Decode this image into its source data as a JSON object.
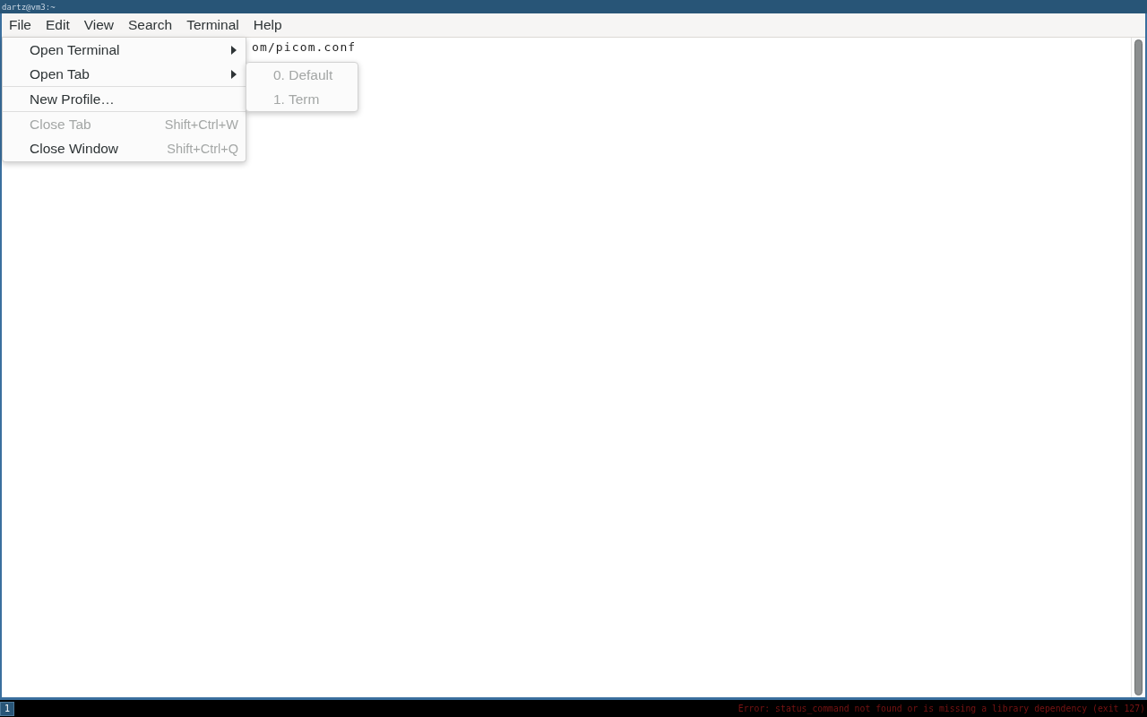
{
  "window": {
    "title": "dartz@vm3:~"
  },
  "menu_bar": [
    {
      "label": "File"
    },
    {
      "label": "Edit"
    },
    {
      "label": "View"
    },
    {
      "label": "Search"
    },
    {
      "label": "Terminal"
    },
    {
      "label": "Help"
    }
  ],
  "terminal": {
    "visible_lines": [
      "om/picom.conf"
    ]
  },
  "file_menu": {
    "items": [
      {
        "kind": "submenu",
        "label": "Open Terminal",
        "disabled": false
      },
      {
        "kind": "submenu",
        "label": "Open Tab",
        "disabled": false,
        "submenu_items": [
          {
            "label": "0. Default",
            "disabled": true
          },
          {
            "label": "1. Term",
            "disabled": true
          }
        ]
      },
      {
        "kind": "separator"
      },
      {
        "kind": "action",
        "label": "New Profile…",
        "disabled": false
      },
      {
        "kind": "separator"
      },
      {
        "kind": "action",
        "label": "Close Tab",
        "shortcut": "Shift+Ctrl+W",
        "disabled": true
      },
      {
        "kind": "action",
        "label": "Close Window",
        "shortcut": "Shift+Ctrl+Q",
        "disabled": false
      }
    ]
  },
  "status_bar": {
    "workspaces": [
      {
        "label": "1",
        "selected": true
      }
    ],
    "status": "Error: status_command not found or is missing a library dependency (exit 127)"
  }
}
